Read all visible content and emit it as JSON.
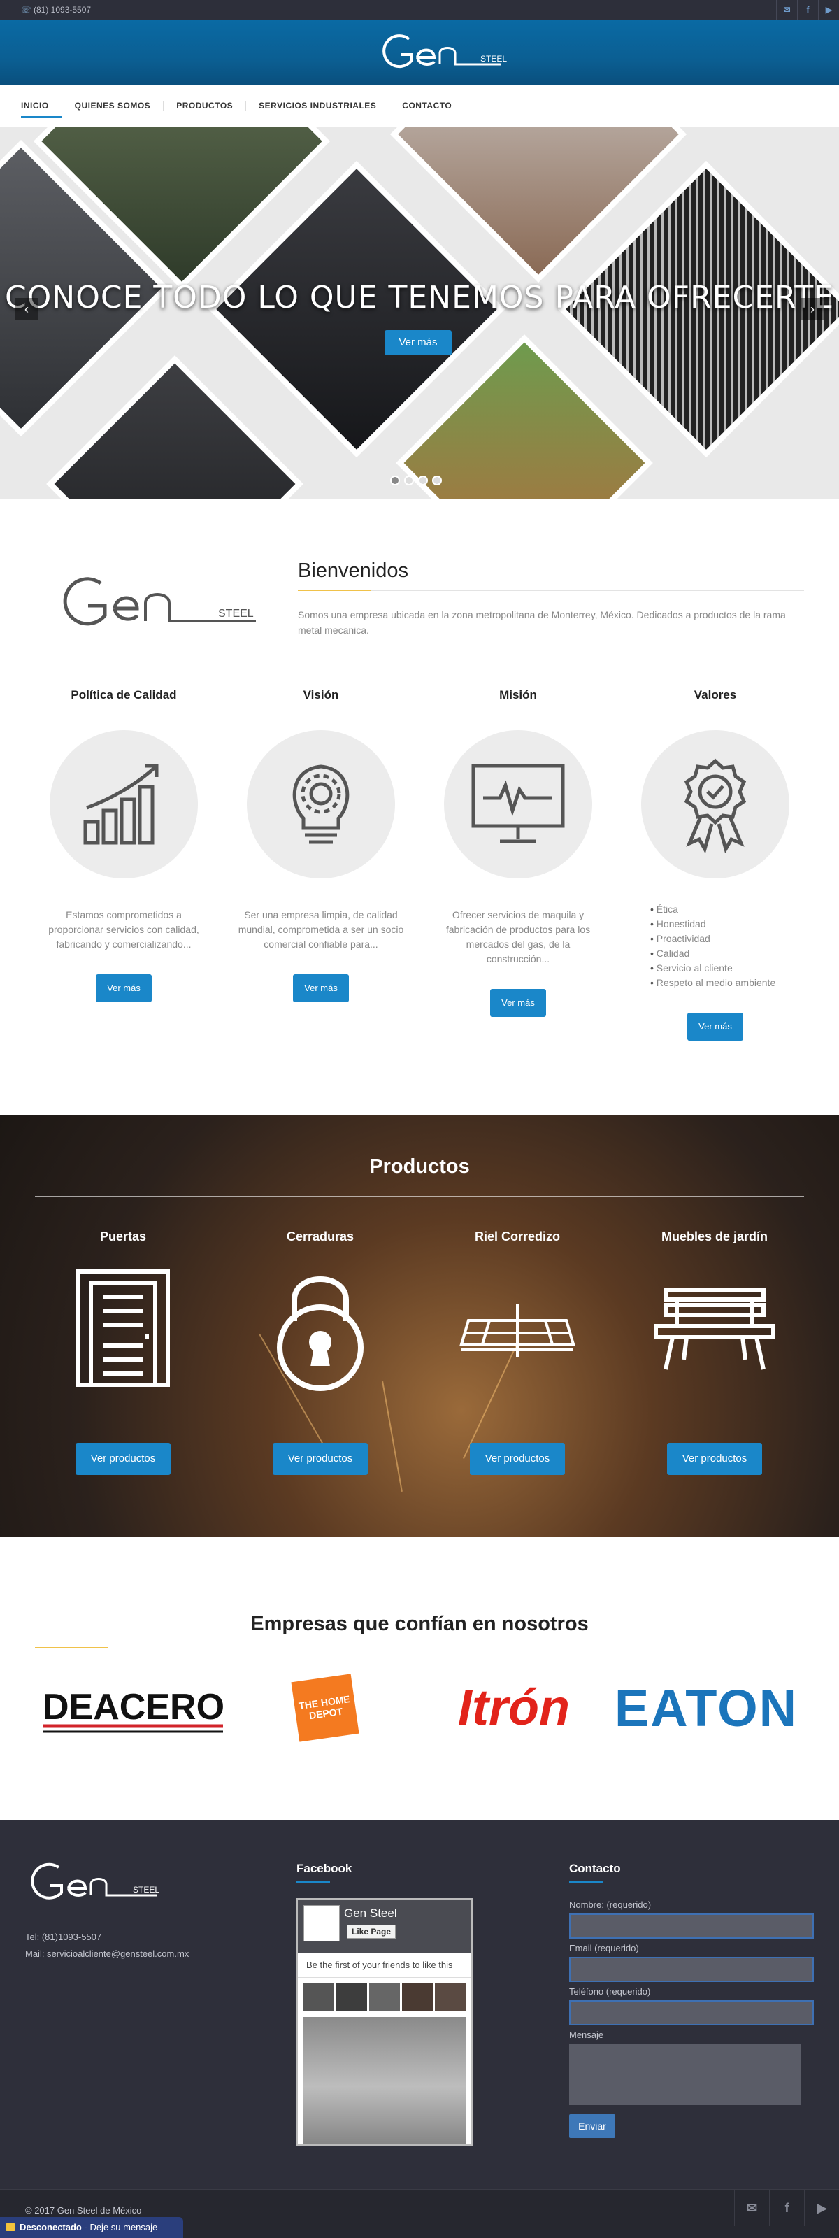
{
  "topbar": {
    "phone": "(81) 1093-5507"
  },
  "brand": {
    "logo_text": "Gen",
    "logo_sub": "STEEL"
  },
  "nav": {
    "items": [
      "INICIO",
      "QUIENES SOMOS",
      "PRODUCTOS",
      "SERVICIOS INDUSTRIALES",
      "CONTACTO"
    ],
    "active": "INICIO"
  },
  "hero": {
    "headline": "CONOCE TODO LO QUE TENEMOS PARA OFRECERTE",
    "button": "Ver más",
    "prev": "‹",
    "next": "›"
  },
  "welcome": {
    "title": "Bienvenidos",
    "text": "Somos una empresa ubicada en la zona metropolitana de Monterrey, México. Dedicados a productos de la rama metal mecanica."
  },
  "features": [
    {
      "title": "Política de Calidad",
      "text": "Estamos comprometidos a proporcionar servicios con calidad, fabricando y comercializando...",
      "button": "Ver más",
      "icon": "bar-chart-icon"
    },
    {
      "title": "Visión",
      "text": "Ser una empresa limpia, de calidad mundial, comprometida a ser un socio comercial confiable para...",
      "button": "Ver más",
      "icon": "lightbulb-icon"
    },
    {
      "title": "Misión",
      "text": "Ofrecer servicios de maquila y fabricación de productos para los mercados del gas, de la construcción...",
      "button": "Ver más",
      "icon": "monitor-icon"
    },
    {
      "title": "Valores",
      "list": [
        "Ética",
        "Honestidad",
        "Proactividad",
        "Calidad",
        "Servicio al cliente",
        "Respeto al medio ambiente"
      ],
      "button": "Ver más",
      "icon": "award-icon"
    }
  ],
  "products": {
    "title": "Productos",
    "items": [
      {
        "name": "Puertas",
        "button": "Ver productos",
        "icon": "door-icon"
      },
      {
        "name": "Cerraduras",
        "button": "Ver productos",
        "icon": "padlock-icon"
      },
      {
        "name": "Riel Corredizo",
        "button": "Ver productos",
        "icon": "rail-icon"
      },
      {
        "name": "Muebles de jardín",
        "button": "Ver productos",
        "icon": "bench-icon"
      }
    ]
  },
  "clients": {
    "title": "Empresas que confían en nosotros",
    "logos": [
      "DEACERO",
      "THE HOME DEPOT",
      "Itrón",
      "EATON"
    ]
  },
  "footer": {
    "tel": "Tel: (81)1093-5507",
    "mail": "Mail: servicioalcliente@gensteel.com.mx",
    "facebook_title": "Facebook",
    "fb_page": "Gen Steel",
    "fb_like": "Like Page",
    "fb_friends": "Be the first of your friends to like this",
    "contact_title": "Contacto",
    "form": {
      "name": "Nombre: (requerido)",
      "email": "Email (requerido)",
      "phone": "Teléfono (requerido)",
      "message": "Mensaje",
      "send": "Enviar"
    },
    "copyright": "© 2017 Gen Steel de México"
  },
  "chat": {
    "status": "Desconectado",
    "cta": "Deje su mensaje"
  },
  "colors": {
    "accent": "#1a87c9",
    "header": "#0b5f93",
    "footer": "#2e2f3a",
    "gold": "#f0c24a"
  }
}
